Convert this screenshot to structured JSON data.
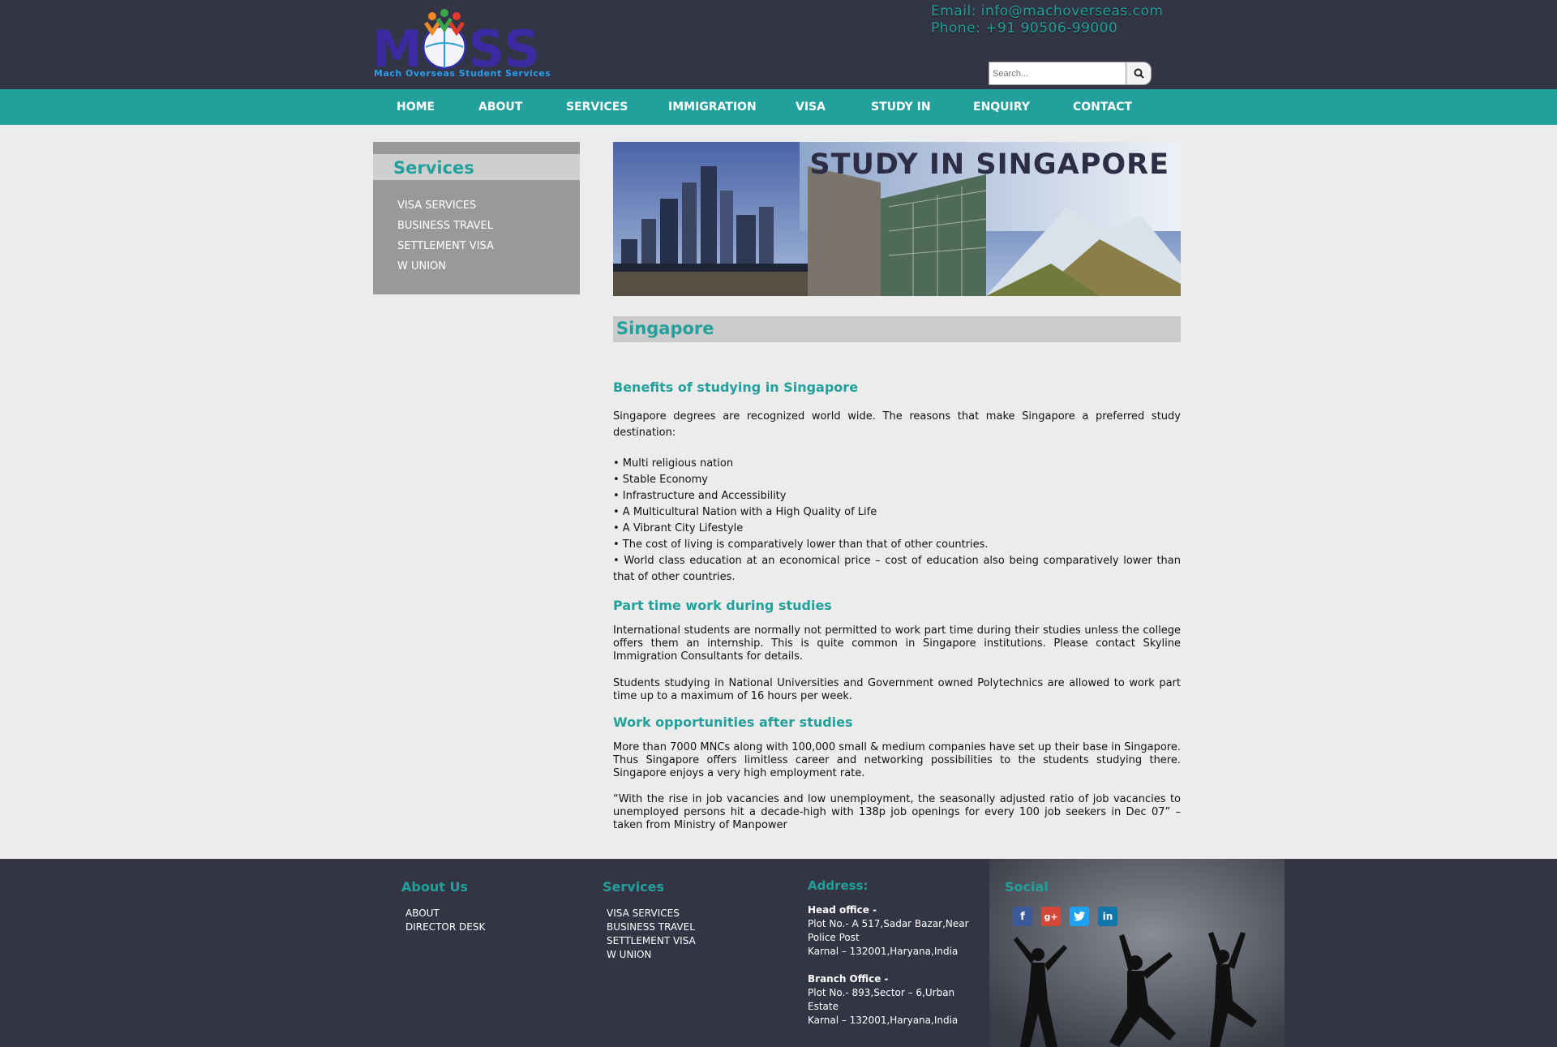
{
  "header": {
    "logo_text": "MOSS",
    "logo_tagline": "Mach Overseas Student Services",
    "email": "Email: info@machoverseas.com",
    "phone": "Phone: +91 90506-99000",
    "search_placeholder": "Search...",
    "search_icon": "search-icon"
  },
  "nav": [
    "HOME",
    "ABOUT",
    "SERVICES",
    "IMMIGRATION",
    "VISA",
    "STUDY IN",
    "ENQUIRY",
    "CONTACT"
  ],
  "sidebar": {
    "title": "Services",
    "items": [
      "VISA SERVICES",
      "BUSINESS TRAVEL",
      "SETTLEMENT VISA",
      "W UNION"
    ]
  },
  "banner": {
    "title": "STUDY IN SINGAPORE"
  },
  "main": {
    "title": "Singapore",
    "sections": {
      "benefits_heading": "Benefits of studying in Singapore",
      "benefits_intro": "Singapore degrees are recognized world wide. The reasons that make Singapore a preferred study destination:",
      "benefits_list": [
        "• Multi religious nation",
        "• Stable Economy",
        "• Infrastructure and Accessibility",
        "• A Multicultural Nation with a High Quality of Life",
        "• A Vibrant City Lifestyle",
        "• The cost of living is comparatively lower than that of other countries.",
        "• World class education at an economical price – cost of education also being comparatively lower than that of other countries."
      ],
      "parttime_heading": "Part time work during studies",
      "parttime_p1": "International students are normally not permitted to work part time during their studies unless the college offers them an internship. This is quite common in Singapore institutions. Please contact Skyline Immigration Consultants for details.",
      "parttime_p2": "Students studying in National Universities and Government owned Polytechnics are allowed to work part time up to a maximum of 16 hours per week.",
      "work_heading": "Work opportunities after studies",
      "work_p1": "More than 7000 MNCs along with 100,000 small & medium companies have set up their base in Singapore. Thus Singapore offers limitless career and networking possibilities to the students studying there. Singapore enjoys a very high employment rate.",
      "work_p2": "“With the rise in job vacancies and low unemployment, the seasonally adjusted ratio of job vacancies to unemployed persons hit a decade-high with 138p job openings for every 100 job seekers in Dec 07” – taken from Ministry of Manpower"
    }
  },
  "footer": {
    "about_title": "About Us",
    "about_items": [
      "ABOUT",
      "DIRECTOR DESK"
    ],
    "services_title": "Services",
    "services_items": [
      "VISA SERVICES",
      "BUSINESS TRAVEL",
      "SETTLEMENT VISA",
      "W UNION"
    ],
    "address_title": "Address:",
    "head_label": "Head office -",
    "head_line1": "Plot No.- A 517,Sadar Bazar,Near Police Post",
    "head_line2": "Karnal – 132001,Haryana,India",
    "branch_label": "Branch Office -",
    "branch_line1": "Plot No.- 893,Sector – 6,Urban Estate",
    "branch_line2": "Karnal – 132001,Haryana,India",
    "social_title": "Social",
    "social_icons": [
      "facebook-icon",
      "google-plus-icon",
      "twitter-icon",
      "linkedin-icon"
    ],
    "social_colors": [
      "#3b5998",
      "#d34836",
      "#1da1f2",
      "#0e76a8"
    ]
  },
  "colors": {
    "header_bg": "#333545",
    "accent": "#22a09b",
    "sidebar_bg": "#999999",
    "page_bg": "#ececec"
  }
}
